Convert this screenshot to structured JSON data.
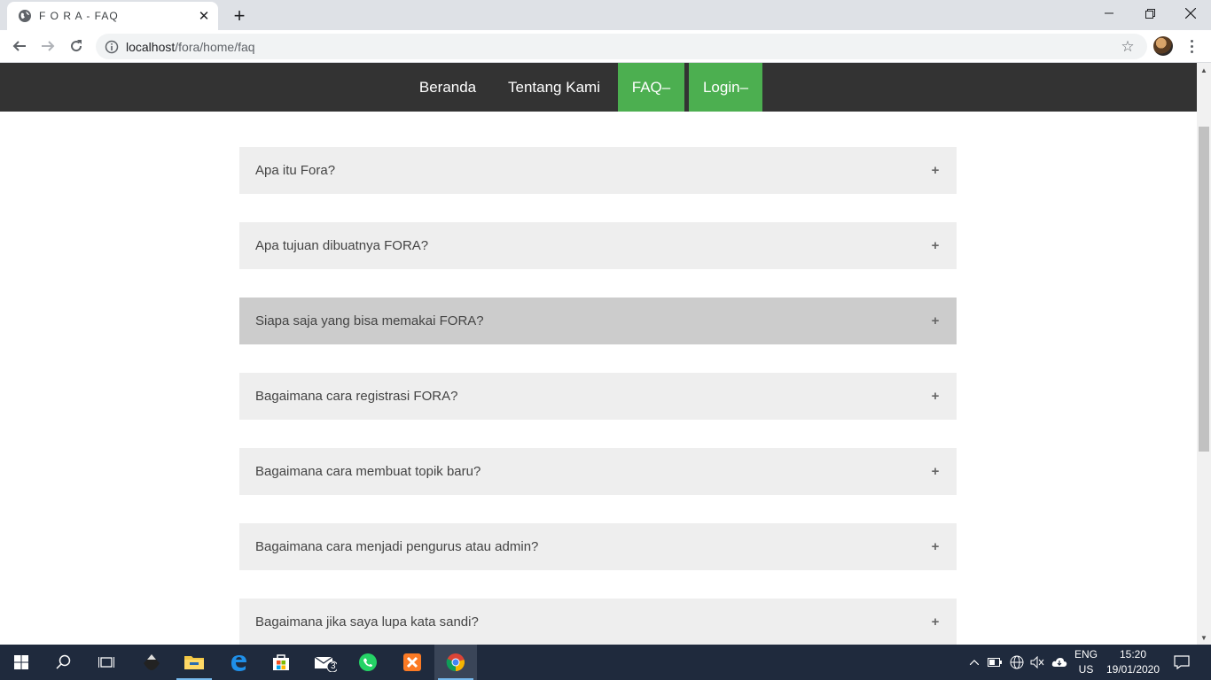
{
  "browser": {
    "tab_title": "F O R A - FAQ",
    "url_host": "localhost",
    "url_path": "/fora/home/faq",
    "new_tab_symbol": "+",
    "close_symbol": "✕"
  },
  "nav": {
    "items": [
      {
        "label": "Beranda",
        "active": false
      },
      {
        "label": "Tentang Kami",
        "active": false
      },
      {
        "label": "FAQ–",
        "active": true
      },
      {
        "label": "Login–",
        "active": true
      }
    ],
    "bg_color": "#333333",
    "active_color": "#4caf50"
  },
  "faq": {
    "items": [
      {
        "question": "Apa itu Fora?",
        "toggle": "+"
      },
      {
        "question": "Apa tujuan dibuatnya FORA?",
        "toggle": "+"
      },
      {
        "question": "Siapa saja yang bisa memakai FORA?",
        "toggle": "+",
        "hovered": true
      },
      {
        "question": "Bagaimana cara registrasi FORA?",
        "toggle": "+"
      },
      {
        "question": "Bagaimana cara membuat topik baru?",
        "toggle": "+"
      },
      {
        "question": "Bagaimana cara menjadi pengurus atau admin?",
        "toggle": "+"
      },
      {
        "question": "Bagaimana jika saya lupa kata sandi?",
        "toggle": "+"
      }
    ]
  },
  "taskbar": {
    "mail_badge": "3",
    "lang_line1": "ENG",
    "lang_line2": "US",
    "time": "15:20",
    "date": "19/01/2020"
  }
}
